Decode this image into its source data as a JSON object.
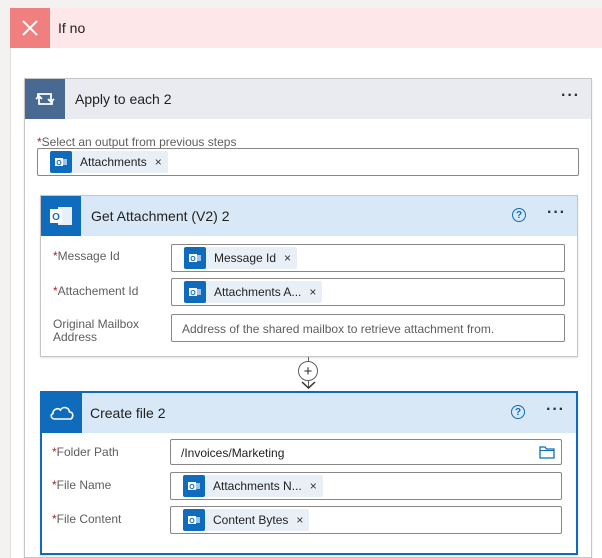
{
  "if_no": {
    "title": "If no",
    "icon": "close-icon"
  },
  "apply_each": {
    "title": "Apply to each 2",
    "more": "···",
    "select_label": "Select an output from previous steps",
    "select_token": "Attachments"
  },
  "get_attachment": {
    "title": "Get Attachment (V2) 2",
    "help": "?",
    "more": "···",
    "message_id_label": "Message Id",
    "message_id_token": "Message Id",
    "attachment_id_label": "Attachement Id",
    "attachment_id_token": "Attachments A...",
    "mailbox_label_line1": "Original Mailbox",
    "mailbox_label_line2": "Address",
    "mailbox_placeholder": "Address of the shared mailbox to retrieve attachment from."
  },
  "add_step": {
    "symbol": "+"
  },
  "create_file": {
    "title": "Create file 2",
    "help": "?",
    "more": "···",
    "folder_label": "Folder Path",
    "folder_value": "/Invoices/Marketing",
    "filename_label": "File Name",
    "filename_token": "Attachments N...",
    "content_label": "File Content",
    "content_token": "Content Bytes"
  },
  "required_marker": "*",
  "token_remove": "×",
  "colors": {
    "accent": "#0f6cbd",
    "loop": "#486991",
    "if_no": "#f08080"
  }
}
